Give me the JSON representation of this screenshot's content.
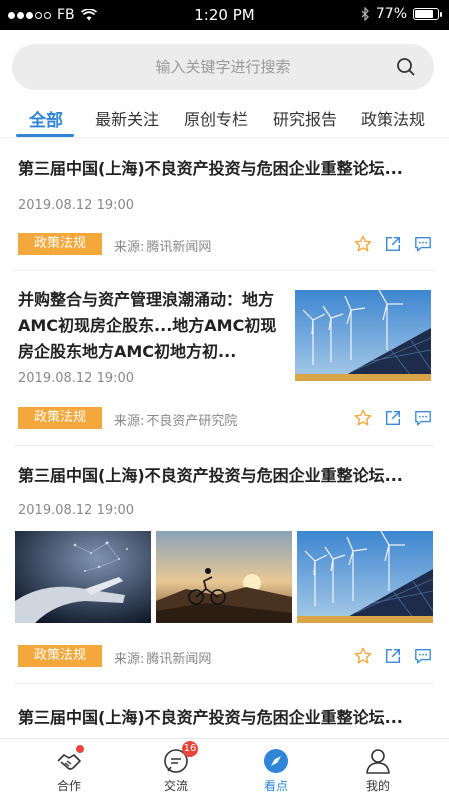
{
  "status_bar": {
    "carrier": "FB",
    "time": "1:20 PM",
    "battery": "77%"
  },
  "search": {
    "placeholder": "输入关键字进行搜索"
  },
  "tabs": [
    {
      "label": "全部"
    },
    {
      "label": "最新关注"
    },
    {
      "label": "原创专栏"
    },
    {
      "label": "研究报告"
    },
    {
      "label": "政策法规"
    }
  ],
  "articles": [
    {
      "title": "第三届中国(上海)不良资产投资与危困企业重整论坛...",
      "time": "2019.08.12  19:00",
      "tag": "政策法规",
      "source_label": "来源:",
      "source": "腾讯新闻网"
    },
    {
      "title": "并购整合与资产管理浪潮涌动：地方AMC初现房企股东...地方AMC初现房企股东地方AMC初地方初...",
      "time": "2019.08.12  19:00",
      "tag": "政策法规",
      "source_label": "来源:",
      "source": "不良资产研究院"
    },
    {
      "title": "第三届中国(上海)不良资产投资与危困企业重整论坛...",
      "time": "2019.08.12  19:00",
      "tag": "政策法规",
      "source_label": "来源:",
      "source": "腾讯新闻网"
    },
    {
      "title": "第三届中国(上海)不良资产投资与危困企业重整论坛..."
    }
  ],
  "bottom_nav": [
    {
      "label": "合作",
      "icon": "handshake-icon"
    },
    {
      "label": "交流",
      "icon": "chat-icon",
      "badge": "16"
    },
    {
      "label": "看点",
      "icon": "compass-icon"
    },
    {
      "label": "我的",
      "icon": "person-icon"
    }
  ],
  "colors": {
    "accent": "#2f86d6",
    "tag": "#f4a73b",
    "badge": "#e8453c"
  }
}
